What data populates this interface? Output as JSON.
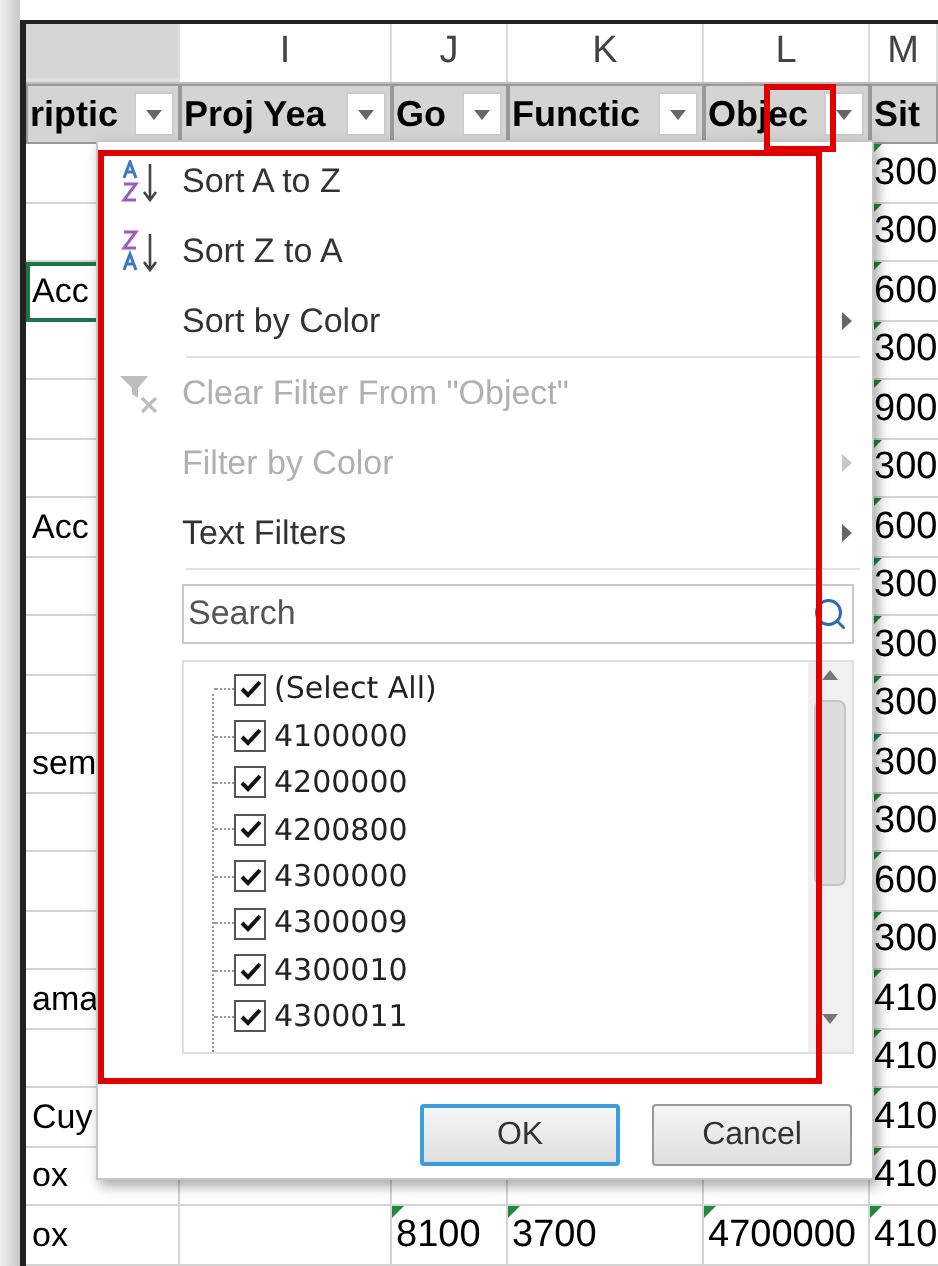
{
  "column_letters": [
    {
      "label": "I"
    },
    {
      "label": "J"
    },
    {
      "label": "K"
    },
    {
      "label": "L"
    },
    {
      "label": "M"
    }
  ],
  "filter_headers": [
    {
      "label": "riptic"
    },
    {
      "label": "Proj Yea"
    },
    {
      "label": "Go"
    },
    {
      "label": "Functic"
    },
    {
      "label": "Objec"
    },
    {
      "label": "Sit"
    }
  ],
  "rows": [
    {
      "lead": {
        "selected": false
      },
      "tail": {
        "text": "300",
        "flagged": true
      }
    },
    {
      "lead": {
        "selected": false
      },
      "tail": {
        "text": "300",
        "flagged": true
      }
    },
    {
      "lead": {
        "text": "Acc",
        "selected": true
      },
      "tail": {
        "text": "600",
        "flagged": true
      }
    },
    {
      "lead": {
        "selected": false
      },
      "tail": {
        "text": "300",
        "flagged": true
      }
    },
    {
      "lead": {
        "selected": false
      },
      "tail": {
        "text": "900",
        "flagged": true
      }
    },
    {
      "lead": {
        "selected": false
      },
      "tail": {
        "text": "300",
        "flagged": true
      }
    },
    {
      "lead": {
        "text": "Acc",
        "selected": false
      },
      "tail": {
        "text": "600",
        "flagged": true
      }
    },
    {
      "lead": {
        "selected": false
      },
      "tail": {
        "text": "300",
        "flagged": true
      }
    },
    {
      "lead": {
        "selected": false
      },
      "tail": {
        "text": "300",
        "flagged": true
      }
    },
    {
      "lead": {
        "selected": false
      },
      "tail": {
        "text": "300",
        "flagged": true
      }
    },
    {
      "lead": {
        "text": "sem",
        "selected": false
      },
      "tail": {
        "text": "300",
        "flagged": true
      }
    },
    {
      "lead": {
        "selected": false
      },
      "tail": {
        "text": "300",
        "flagged": true
      }
    },
    {
      "lead": {
        "selected": false
      },
      "tail": {
        "text": "600",
        "flagged": true
      }
    },
    {
      "lead": {
        "selected": false
      },
      "tail": {
        "text": "300",
        "flagged": true
      }
    },
    {
      "lead": {
        "text": "ama",
        "selected": false
      },
      "tail": {
        "text": "410",
        "flagged": true
      }
    },
    {
      "lead": {
        "selected": false
      },
      "tail": {
        "text": "410",
        "flagged": true
      }
    },
    {
      "lead": {
        "text": "Cuy",
        "selected": false
      },
      "tail": {
        "text": "410",
        "flagged": true
      }
    },
    {
      "lead": {
        "text": "ox",
        "selected": false
      },
      "tail": {
        "text": "410",
        "flagged": true
      }
    },
    {
      "lead": {
        "text": "ox",
        "selected": false
      },
      "middle": [
        {
          "flagged": false
        },
        {
          "text": "8100",
          "flagged": true
        },
        {
          "text": "3700",
          "flagged": true
        },
        {
          "text": "4700000",
          "flagged": true
        }
      ],
      "tail": {
        "text": "410",
        "flagged": true
      }
    }
  ],
  "filter_menu": {
    "items": [
      {
        "kind": "sort-asc",
        "label": "Sort A to Z",
        "disabled": false,
        "submenu": false,
        "separator_after": false
      },
      {
        "kind": "sort-desc",
        "label": "Sort Z to A",
        "disabled": false,
        "submenu": false,
        "separator_after": false
      },
      {
        "kind": "plain",
        "label": "Sort by Color",
        "disabled": false,
        "submenu": true,
        "separator_after": true
      },
      {
        "kind": "clear",
        "label": "Clear Filter From \"Object\"",
        "disabled": true,
        "submenu": false,
        "separator_after": false
      },
      {
        "kind": "plain",
        "label": "Filter by Color",
        "disabled": true,
        "submenu": true,
        "separator_after": false
      },
      {
        "kind": "plain",
        "label": "Text Filters",
        "disabled": false,
        "submenu": true,
        "separator_after": true
      }
    ],
    "search": {
      "placeholder": "Search"
    },
    "values": [
      {
        "label": "(Select All)",
        "checked": true
      },
      {
        "label": "4100000",
        "checked": true
      },
      {
        "label": "4200000",
        "checked": true
      },
      {
        "label": "4200800",
        "checked": true
      },
      {
        "label": "4300000",
        "checked": true
      },
      {
        "label": "4300009",
        "checked": true
      },
      {
        "label": "4300010",
        "checked": true
      },
      {
        "label": "4300011",
        "checked": true
      }
    ],
    "buttons": [
      {
        "label": "OK",
        "default": true
      },
      {
        "label": "Cancel",
        "default": false
      }
    ]
  }
}
